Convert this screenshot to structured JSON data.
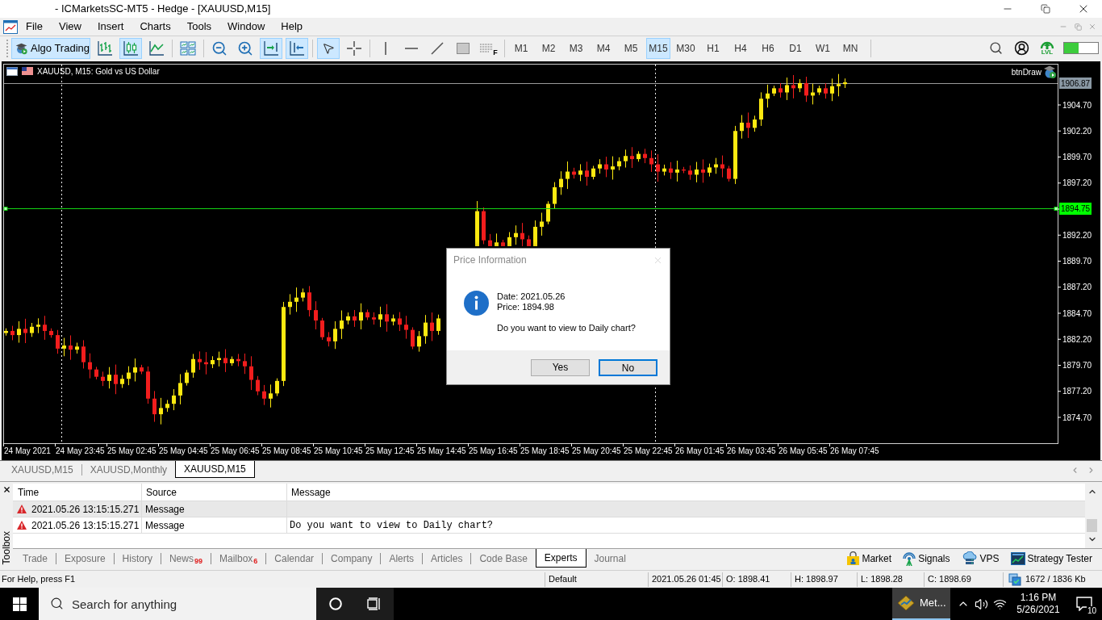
{
  "window": {
    "title": "- ICMarketsSC-MT5 - Hedge - [XAUUSD,M15]"
  },
  "menu": {
    "items": [
      "File",
      "View",
      "Insert",
      "Charts",
      "Tools",
      "Window",
      "Help"
    ]
  },
  "toolbar": {
    "groups": [
      [
        {
          "kind": "algo-trading",
          "label": "Algo Trading",
          "selected": true
        },
        {
          "kind": "bar-chart",
          "selected": false
        },
        {
          "kind": "candlesticks",
          "selected": true
        },
        {
          "kind": "line-chart",
          "selected": false
        }
      ],
      [
        {
          "kind": "templates",
          "selected": false
        }
      ],
      [
        {
          "kind": "zoom-out",
          "selected": false
        },
        {
          "kind": "zoom-in",
          "selected": false
        },
        {
          "kind": "autoscroll",
          "selected": true
        },
        {
          "kind": "chart-shift",
          "selected": true
        }
      ],
      [
        {
          "kind": "cursor",
          "selected": true
        },
        {
          "kind": "crosshair",
          "selected": false
        }
      ],
      [
        {
          "kind": "vertical-line",
          "selected": false
        },
        {
          "kind": "horizontal-line",
          "selected": false
        },
        {
          "kind": "trend-line",
          "selected": false
        },
        {
          "kind": "rectangle",
          "selected": false
        },
        {
          "kind": "fibonacci",
          "label": "F",
          "selected": false
        }
      ]
    ],
    "timeframes": [
      {
        "label": "M1",
        "selected": false
      },
      {
        "label": "M2",
        "selected": false
      },
      {
        "label": "M3",
        "selected": false
      },
      {
        "label": "M4",
        "selected": false
      },
      {
        "label": "M5",
        "selected": false
      },
      {
        "label": "M15",
        "selected": true
      },
      {
        "label": "M30",
        "selected": false
      },
      {
        "label": "H1",
        "selected": false
      },
      {
        "label": "H4",
        "selected": false
      },
      {
        "label": "H6",
        "selected": false
      },
      {
        "label": "D1",
        "selected": false
      },
      {
        "label": "W1",
        "selected": false
      },
      {
        "label": "MN",
        "selected": false
      }
    ],
    "right": [
      {
        "kind": "search"
      },
      {
        "kind": "account"
      },
      {
        "kind": "level-up",
        "label": "LVL"
      },
      {
        "kind": "connection"
      }
    ]
  },
  "chart": {
    "title": "XAUUSD, M15: Gold vs US Dollar",
    "expert_name": "btnDraw",
    "price_labels": [
      "1904.70",
      "1902.20",
      "1899.70",
      "1897.20",
      "1892.20",
      "1889.70",
      "1887.20",
      "1884.70",
      "1882.20",
      "1879.70",
      "1877.20",
      "1874.70"
    ],
    "bid_label": "1906.87",
    "line_label": "1894.75",
    "time_labels": [
      "24 May 2021",
      "24 May 23:45",
      "25 May 02:45",
      "25 May 04:45",
      "25 May 06:45",
      "25 May 08:45",
      "25 May 10:45",
      "25 May 12:45",
      "25 May 14:45",
      "25 May 16:45",
      "25 May 18:45",
      "25 May 20:45",
      "25 May 22:45",
      "26 May 01:45",
      "26 May 03:45",
      "26 May 05:45",
      "26 May 07:45"
    ]
  },
  "dialog": {
    "title": "Price Information",
    "lines": [
      "Date: 2021.05.26",
      "Price: 1894.98"
    ],
    "question": "Do you want to view to Daily chart?",
    "buttons": [
      {
        "label": "Yes",
        "selected": false
      },
      {
        "label": "No",
        "selected": true
      }
    ]
  },
  "chart_tabs": {
    "tabs": [
      {
        "label": "XAUUSD,M15",
        "selected": false
      },
      {
        "label": "XAUUSD,Monthly",
        "selected": false
      },
      {
        "label": "XAUUSD,M15",
        "selected": true
      }
    ]
  },
  "toolbox": {
    "title": "Toolbox",
    "columns": [
      "Time",
      "Source",
      "Message"
    ],
    "rows": [
      {
        "time": "2021.05.26 13:15:15.271",
        "source": "Message",
        "selected": true
      },
      {
        "time": "2021.05.26 13:15:15.271",
        "source": "Message",
        "message": "Do you want to view to Daily chart?",
        "selected": false
      }
    ],
    "tabs": [
      {
        "label": "Trade",
        "selected": false
      },
      {
        "label": "Exposure",
        "selected": false
      },
      {
        "label": "History",
        "selected": false
      },
      {
        "label": "News",
        "badge": "99",
        "selected": false
      },
      {
        "label": "Mailbox",
        "badge": "6",
        "selected": false
      },
      {
        "label": "Calendar",
        "selected": false
      },
      {
        "label": "Company",
        "selected": false
      },
      {
        "label": "Alerts",
        "selected": false
      },
      {
        "label": "Articles",
        "selected": false
      },
      {
        "label": "Code Base",
        "selected": false
      },
      {
        "label": "Experts",
        "selected": true
      },
      {
        "label": "Journal",
        "selected": false
      }
    ],
    "services": [
      {
        "kind": "market",
        "label": "Market"
      },
      {
        "kind": "signals",
        "label": "Signals"
      },
      {
        "kind": "vps",
        "label": "VPS"
      },
      {
        "kind": "strategy-tester",
        "label": "Strategy Tester"
      }
    ]
  },
  "status_bar": {
    "help": "For Help, press F1",
    "fields": [
      "Default",
      "2021.05.26 01:45",
      "O: 1898.41",
      "H: 1898.97",
      "L: 1898.28",
      "C: 1898.69"
    ],
    "memory": "1672 / 1836 Kb"
  },
  "taskbar": {
    "search_placeholder": "Search for anything",
    "apps": [
      {
        "label": "Met...",
        "selected": true
      }
    ],
    "clock": {
      "time": "1:16 PM",
      "date": "5/26/2021"
    },
    "notifications": "10"
  }
}
